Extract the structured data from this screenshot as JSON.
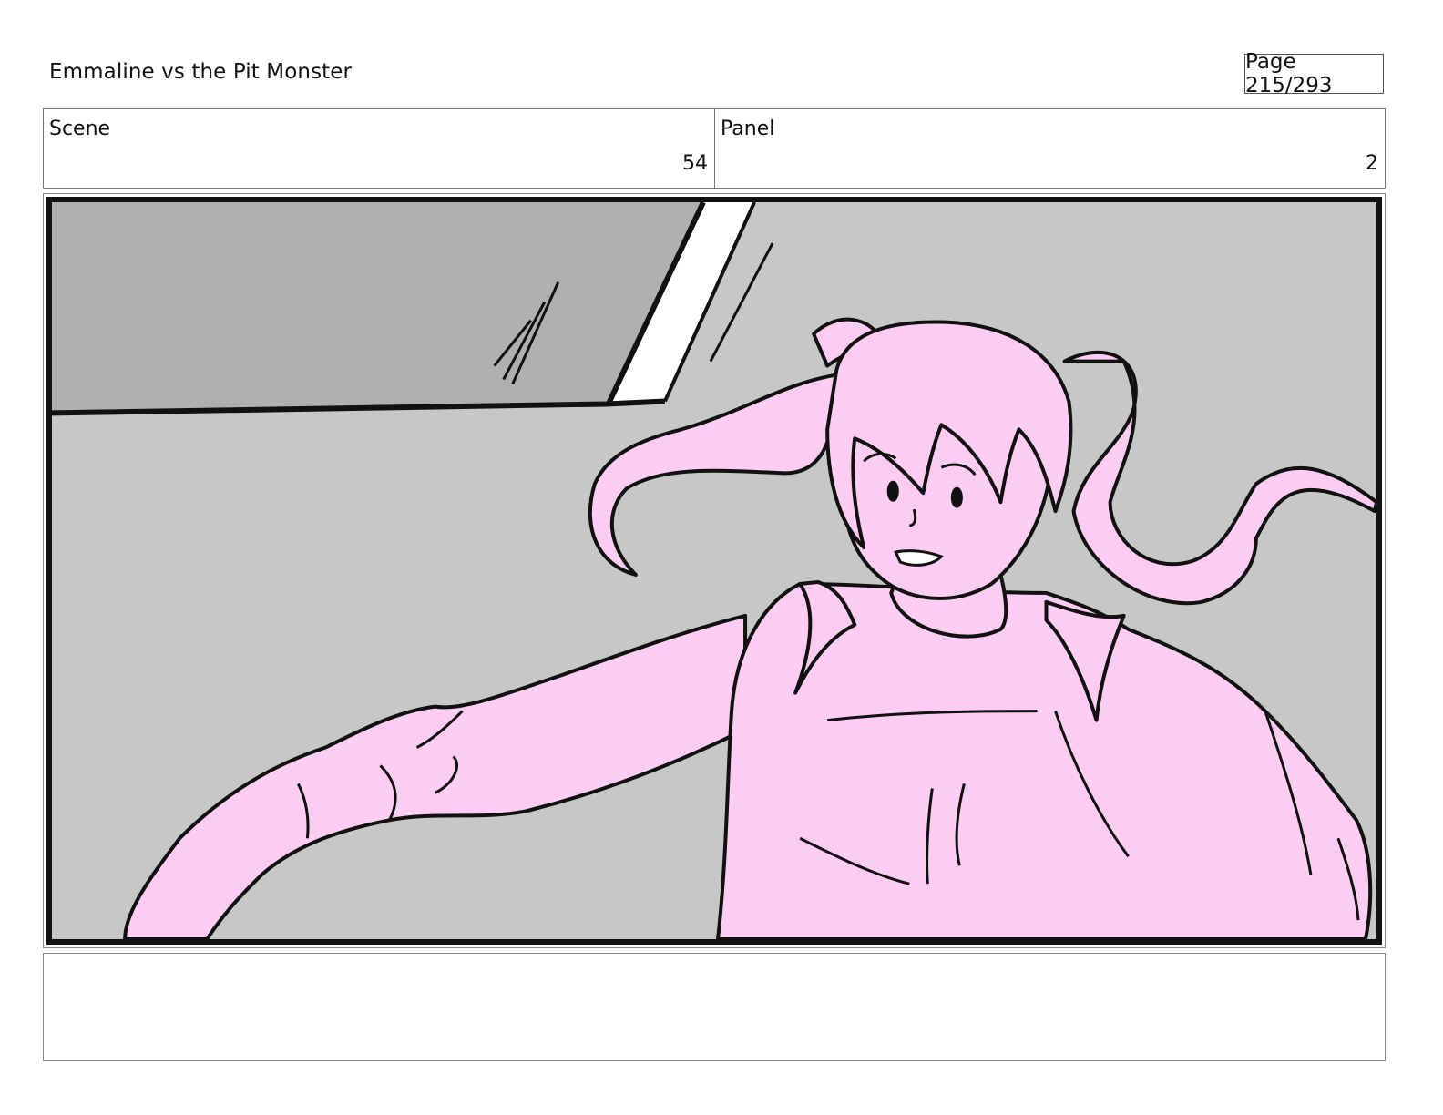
{
  "header": {
    "title": "Emmaline vs the Pit Monster",
    "page_label": "Page 215/293"
  },
  "info": {
    "scene_label": "Scene",
    "scene_value": "54",
    "panel_label": "Panel",
    "panel_value": "2"
  },
  "colors": {
    "background": "#c7c7c7",
    "ceiling": "#b0b0b0",
    "character_fill": "#fbcdf2",
    "ink": "#111111",
    "frame_border": "#1f3a22"
  },
  "notes": {
    "text": ""
  }
}
